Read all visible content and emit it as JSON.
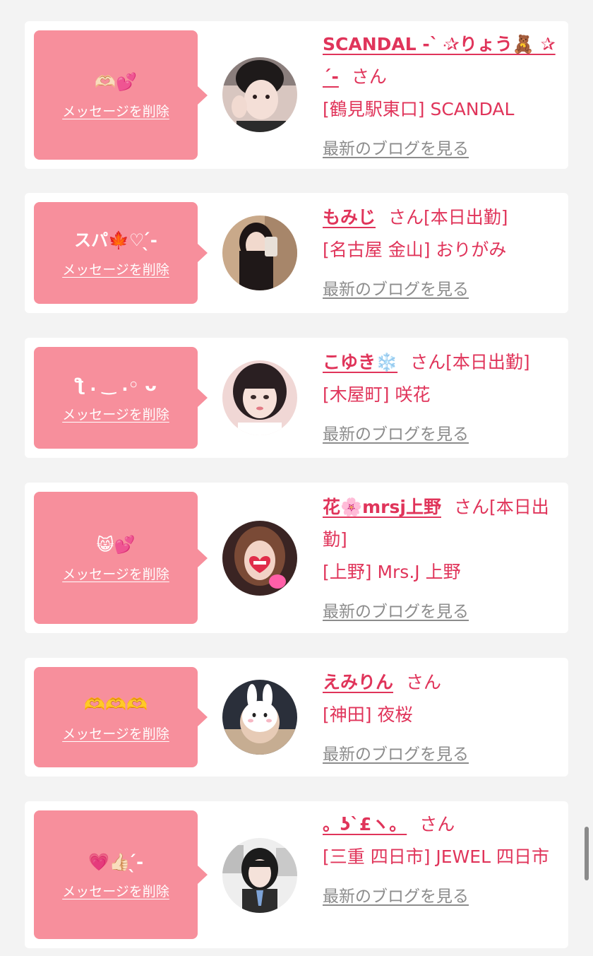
{
  "messages": [
    {
      "message": "🫶🏻💕",
      "delete_label": "メッセージを削除",
      "name": "SCANDAL -`ּ ✰りょう🧸 ✰ ´-",
      "honorific": "さん",
      "status": "",
      "shop": "[鶴見駅東口] SCANDAL",
      "blog_label": "最新のブログを見る"
    },
    {
      "message": "スパ🍁♡ ̖́-",
      "delete_label": "メッセージを削除",
      "name": "もみじ",
      "honorific": "さん",
      "status": "[本日出勤]",
      "shop": "[名古屋 金山] おりがみ",
      "blog_label": "最新のブログを見る"
    },
    {
      "message": "ƪ ․ ‿ .◦ ᴗ",
      "delete_label": "メッセージを削除",
      "name": "こゆき❄️",
      "honorific": "さん",
      "status": "[本日出勤]",
      "shop": "[木屋町] 咲花",
      "blog_label": "最新のブログを見る"
    },
    {
      "message": "😸💕",
      "delete_label": "メッセージを削除",
      "name": "花🌸mrsj上野",
      "honorific": "さん",
      "status": "[本日出勤]",
      "shop": "[上野] Mrs.J 上野",
      "blog_label": "最新のブログを見る"
    },
    {
      "message": "🫶🫶🫶",
      "delete_label": "メッセージを削除",
      "name": "えみりん",
      "honorific": "さん",
      "status": "",
      "shop": "[神田] 夜桜",
      "blog_label": "最新のブログを見る"
    },
    {
      "message": "💗👍🏻 ̖́-",
      "delete_label": "メッセージを削除",
      "name": "。ʖˋ£ヽ。",
      "honorific": "さん",
      "status": "",
      "shop": "[三重 四日市] JEWEL 四日市",
      "blog_label": "最新のブログを見る"
    }
  ],
  "avatars": [
    {
      "icon": "avatar-photo",
      "bg": "#d8c6c0"
    },
    {
      "icon": "avatar-photo",
      "bg": "#c9a98a"
    },
    {
      "icon": "avatar-photo",
      "bg": "#f0d7d5"
    },
    {
      "icon": "avatar-photo",
      "bg": "#3a2423"
    },
    {
      "icon": "avatar-photo",
      "bg": "#2a2f3a"
    },
    {
      "icon": "avatar-photo",
      "bg": "#eeeeee"
    }
  ],
  "colors": {
    "bubble": "#f78f9c",
    "accent": "#e0345a",
    "link_gray": "#8c8c8c",
    "background": "#f3f3f3"
  }
}
